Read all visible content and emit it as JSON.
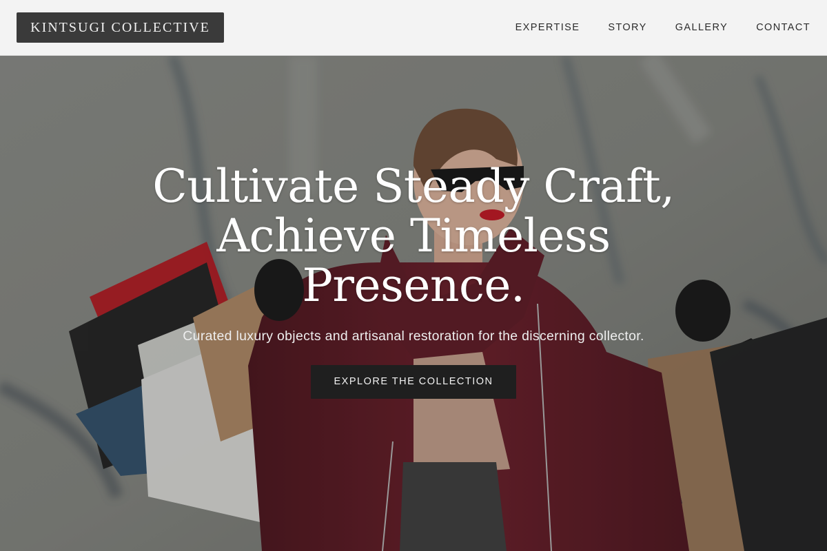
{
  "header": {
    "logo": "KINTSUGI COLLECTIVE",
    "nav": [
      {
        "label": "EXPERTISE"
      },
      {
        "label": "STORY"
      },
      {
        "label": "GALLERY"
      },
      {
        "label": "CONTACT"
      }
    ]
  },
  "hero": {
    "title_lines": [
      "Cultivate Steady Craft,",
      "Achieve Timeless",
      "Presence."
    ],
    "subtitle": "Curated luxury objects and artisanal restoration for the discerning collector.",
    "cta_label": "EXPLORE THE COLLECTION",
    "image_subject": "woman in red coat and sunglasses holding shopping bags"
  },
  "colors": {
    "header_bg": "#f3f3f3",
    "logo_bg": "#3a3a3a",
    "cta_bg": "#1f1f1f",
    "coat": "#6b1a26",
    "lips": "#c6121f"
  }
}
